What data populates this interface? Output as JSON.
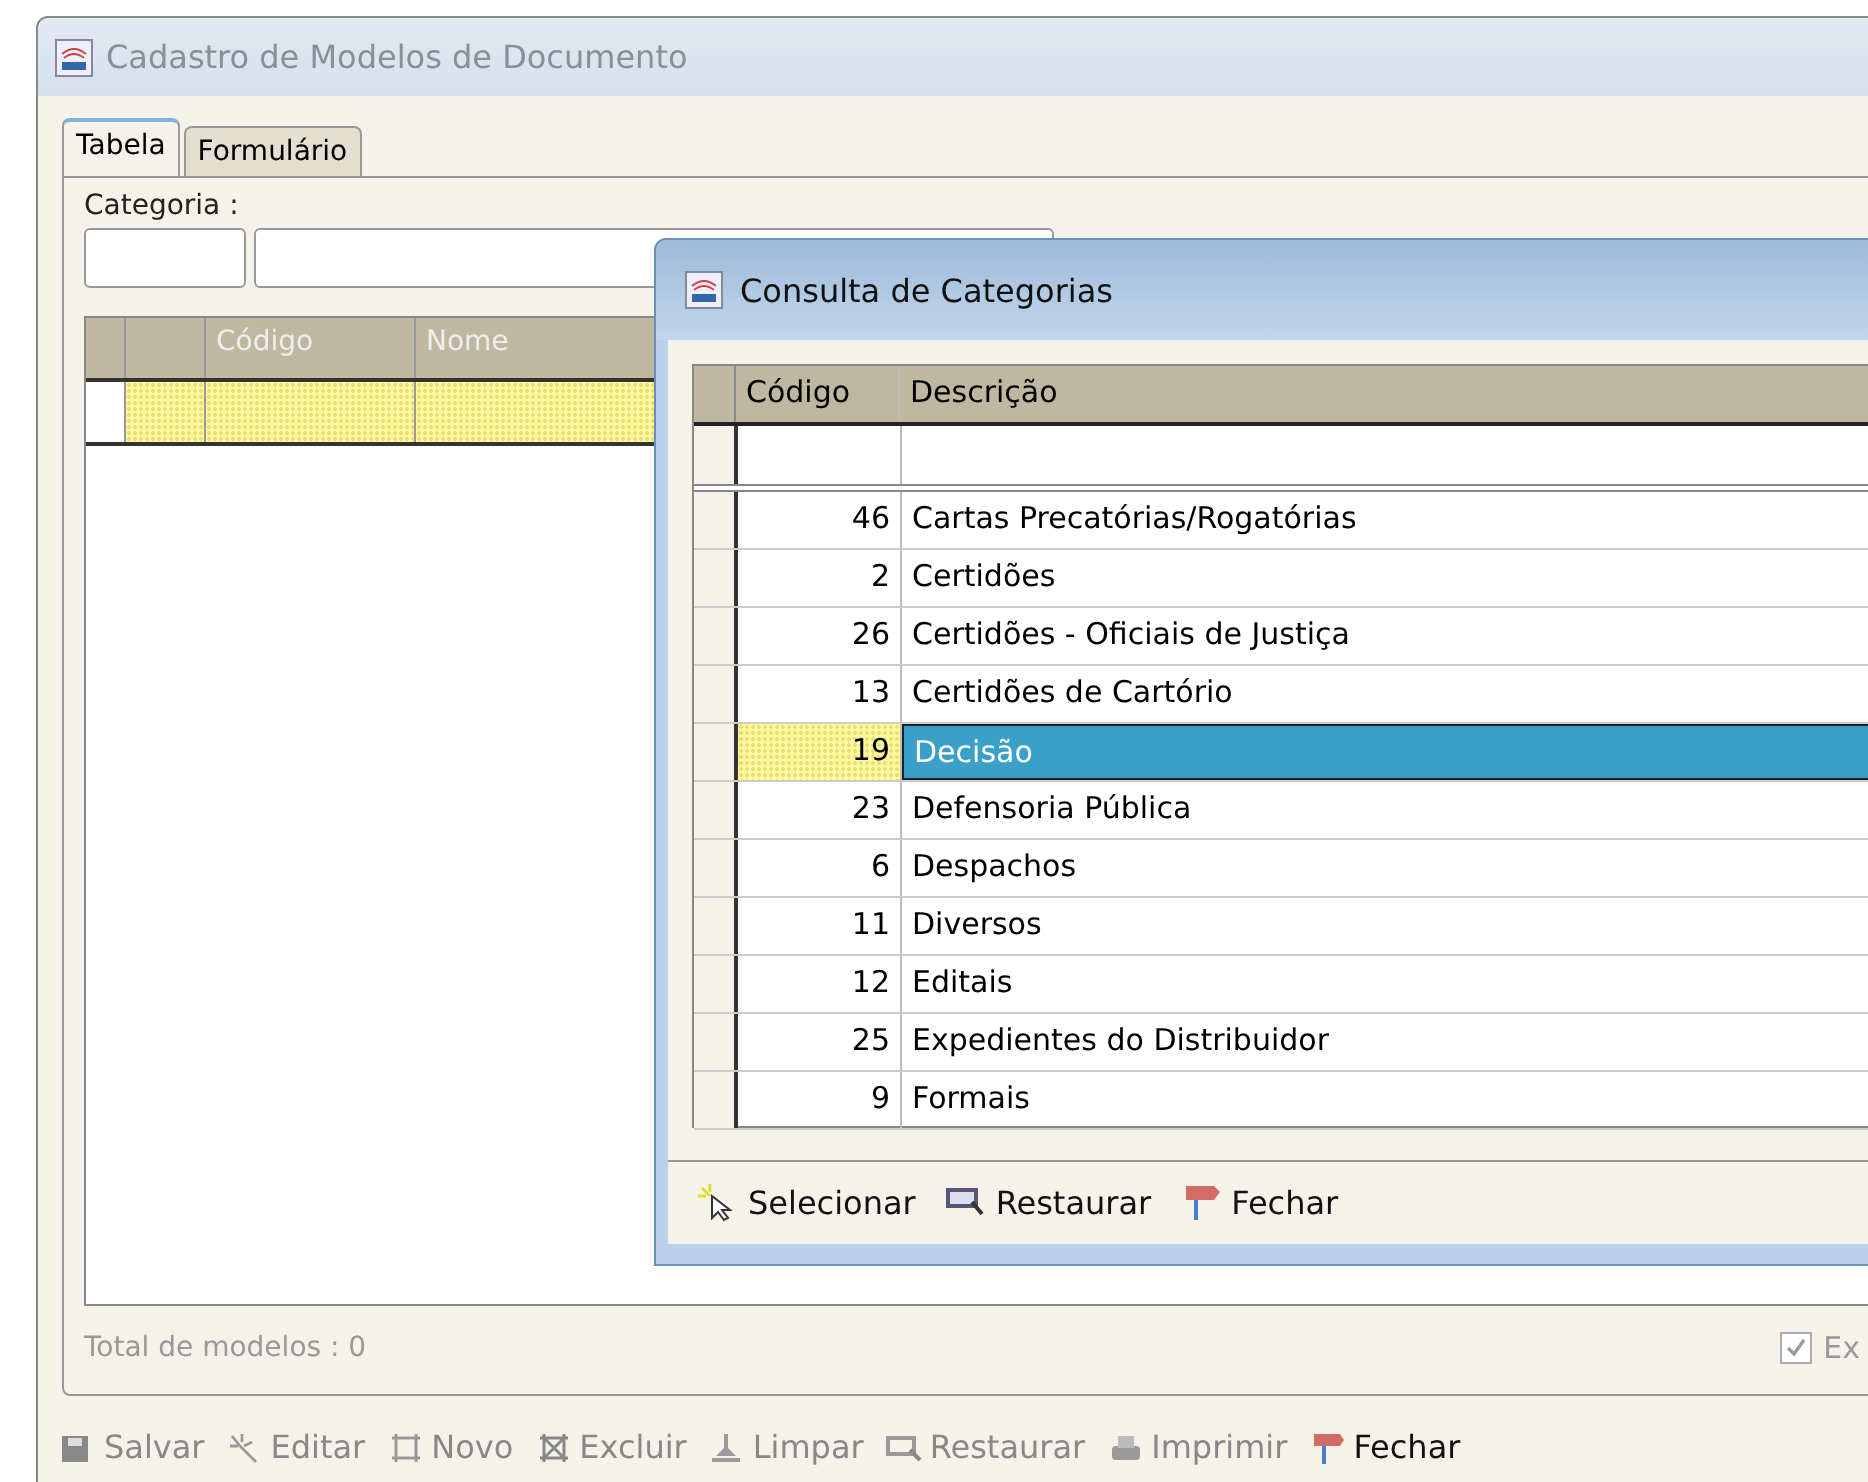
{
  "window": {
    "title": "Cadastro de Modelos de Documento"
  },
  "tabs": [
    {
      "label": "Tabela",
      "selected": true
    },
    {
      "label": "Formulário",
      "selected": false
    }
  ],
  "category_label": "Categoria :",
  "grid": {
    "columns": [
      "Código",
      "Nome"
    ]
  },
  "total": "Total de modelos : 0",
  "checkbox": {
    "label": "Ex",
    "checked": true
  },
  "toolbar": [
    {
      "label": "Salvar",
      "kind": "save",
      "disabled": true
    },
    {
      "label": "Editar",
      "kind": "edit",
      "disabled": true
    },
    {
      "label": "Novo",
      "kind": "new",
      "disabled": true
    },
    {
      "label": "Excluir",
      "kind": "delete",
      "disabled": true
    },
    {
      "label": "Limpar",
      "kind": "clear",
      "disabled": true
    },
    {
      "label": "Restaurar",
      "kind": "restore",
      "disabled": true
    },
    {
      "label": "Imprimir",
      "kind": "print",
      "disabled": true
    },
    {
      "label": "Fechar",
      "kind": "close",
      "disabled": false
    }
  ],
  "dialog": {
    "title": "Consulta de Categorias",
    "columns": [
      "Código",
      "Descrição"
    ],
    "rows": [
      {
        "code": "46",
        "description": "Cartas Precatórias/Rogatórias",
        "selected": false
      },
      {
        "code": "2",
        "description": "Certidões",
        "selected": false
      },
      {
        "code": "26",
        "description": "Certidões - Oficiais de Justiça",
        "selected": false
      },
      {
        "code": "13",
        "description": "Certidões de Cartório",
        "selected": false
      },
      {
        "code": "19",
        "description": "Decisão",
        "selected": true
      },
      {
        "code": "23",
        "description": "Defensoria Pública",
        "selected": false
      },
      {
        "code": "6",
        "description": "Despachos",
        "selected": false
      },
      {
        "code": "11",
        "description": "Diversos",
        "selected": false
      },
      {
        "code": "12",
        "description": "Editais",
        "selected": false
      },
      {
        "code": "25",
        "description": "Expedientes do Distribuidor",
        "selected": false
      },
      {
        "code": "9",
        "description": "Formais",
        "selected": false
      }
    ],
    "buttons": [
      {
        "label": "Selecionar",
        "kind": "select"
      },
      {
        "label": "Restaurar",
        "kind": "restore"
      },
      {
        "label": "Fechar",
        "kind": "close"
      }
    ]
  }
}
